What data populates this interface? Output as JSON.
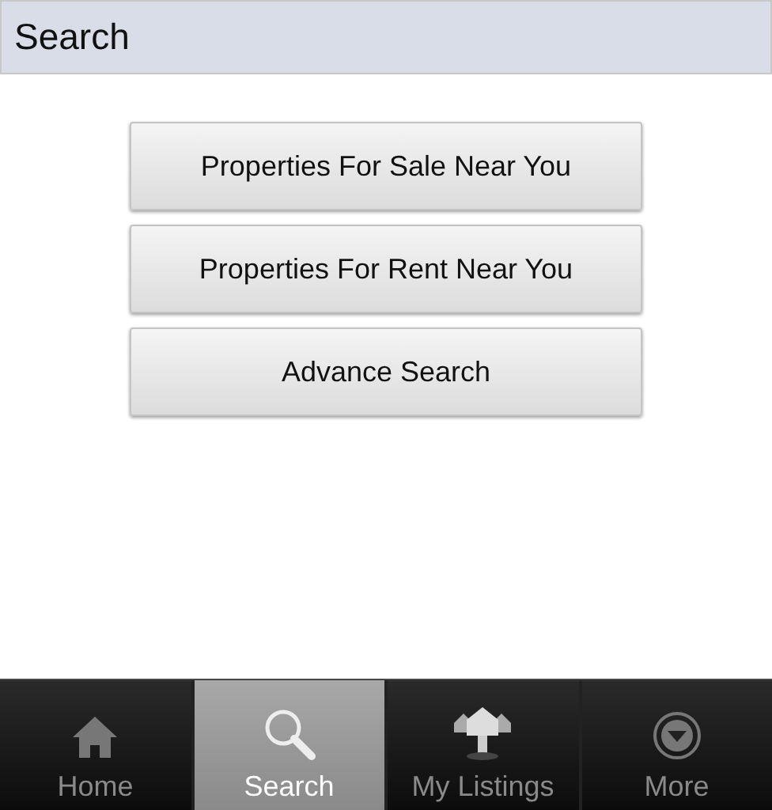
{
  "header": {
    "title": "Search"
  },
  "buttons": [
    {
      "label": "Properties For Sale Near You"
    },
    {
      "label": "Properties For Rent Near You"
    },
    {
      "label": "Advance Search"
    }
  ],
  "tabs": [
    {
      "label": "Home",
      "kind": "home",
      "selected": false
    },
    {
      "label": "Search",
      "kind": "search",
      "selected": true
    },
    {
      "label": "My Listings",
      "kind": "listings",
      "selected": false
    },
    {
      "label": "More",
      "kind": "more",
      "selected": false
    }
  ]
}
